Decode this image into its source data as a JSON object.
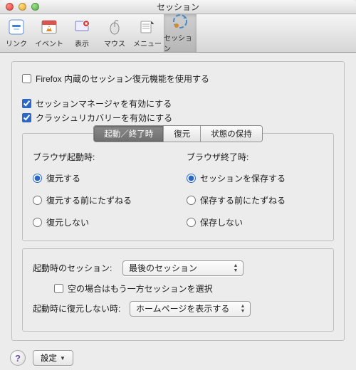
{
  "window": {
    "title": "セッション"
  },
  "toolbar": {
    "items": [
      {
        "label": "リンク"
      },
      {
        "label": "イベント"
      },
      {
        "label": "表示"
      },
      {
        "label": "マウス"
      },
      {
        "label": "メニュー"
      },
      {
        "label": "セッション"
      }
    ]
  },
  "options": {
    "use_firefox_builtin": {
      "label": "Firefox 内蔵のセッション復元機能を使用する",
      "checked": false
    },
    "enable_session_manager": {
      "label": "セッションマネージャを有効にする",
      "checked": true
    },
    "enable_crash_recovery": {
      "label": "クラッシュリカバリーを有効にする",
      "checked": true
    }
  },
  "tabs": {
    "items": [
      {
        "label": "起動／終了時",
        "selected": true
      },
      {
        "label": "復元",
        "selected": false
      },
      {
        "label": "状態の保持",
        "selected": false
      }
    ]
  },
  "startup": {
    "title": "ブラウザ起動時:",
    "options": [
      {
        "label": "復元する",
        "checked": true
      },
      {
        "label": "復元する前にたずねる",
        "checked": false
      },
      {
        "label": "復元しない",
        "checked": false
      }
    ]
  },
  "shutdown": {
    "title": "ブラウザ終了時:",
    "options": [
      {
        "label": "セッションを保存する",
        "checked": true
      },
      {
        "label": "保存する前にたずねる",
        "checked": false
      },
      {
        "label": "保存しない",
        "checked": false
      }
    ]
  },
  "startup_session": {
    "label": "起動時のセッション:",
    "value": "最後のセッション",
    "fallback": {
      "label": "空の場合はもう一方セッションを選択",
      "checked": false
    }
  },
  "no_restore": {
    "label": "起動時に復元しない時:",
    "value": "ホームページを表示する"
  },
  "footer": {
    "settings_label": "設定"
  }
}
